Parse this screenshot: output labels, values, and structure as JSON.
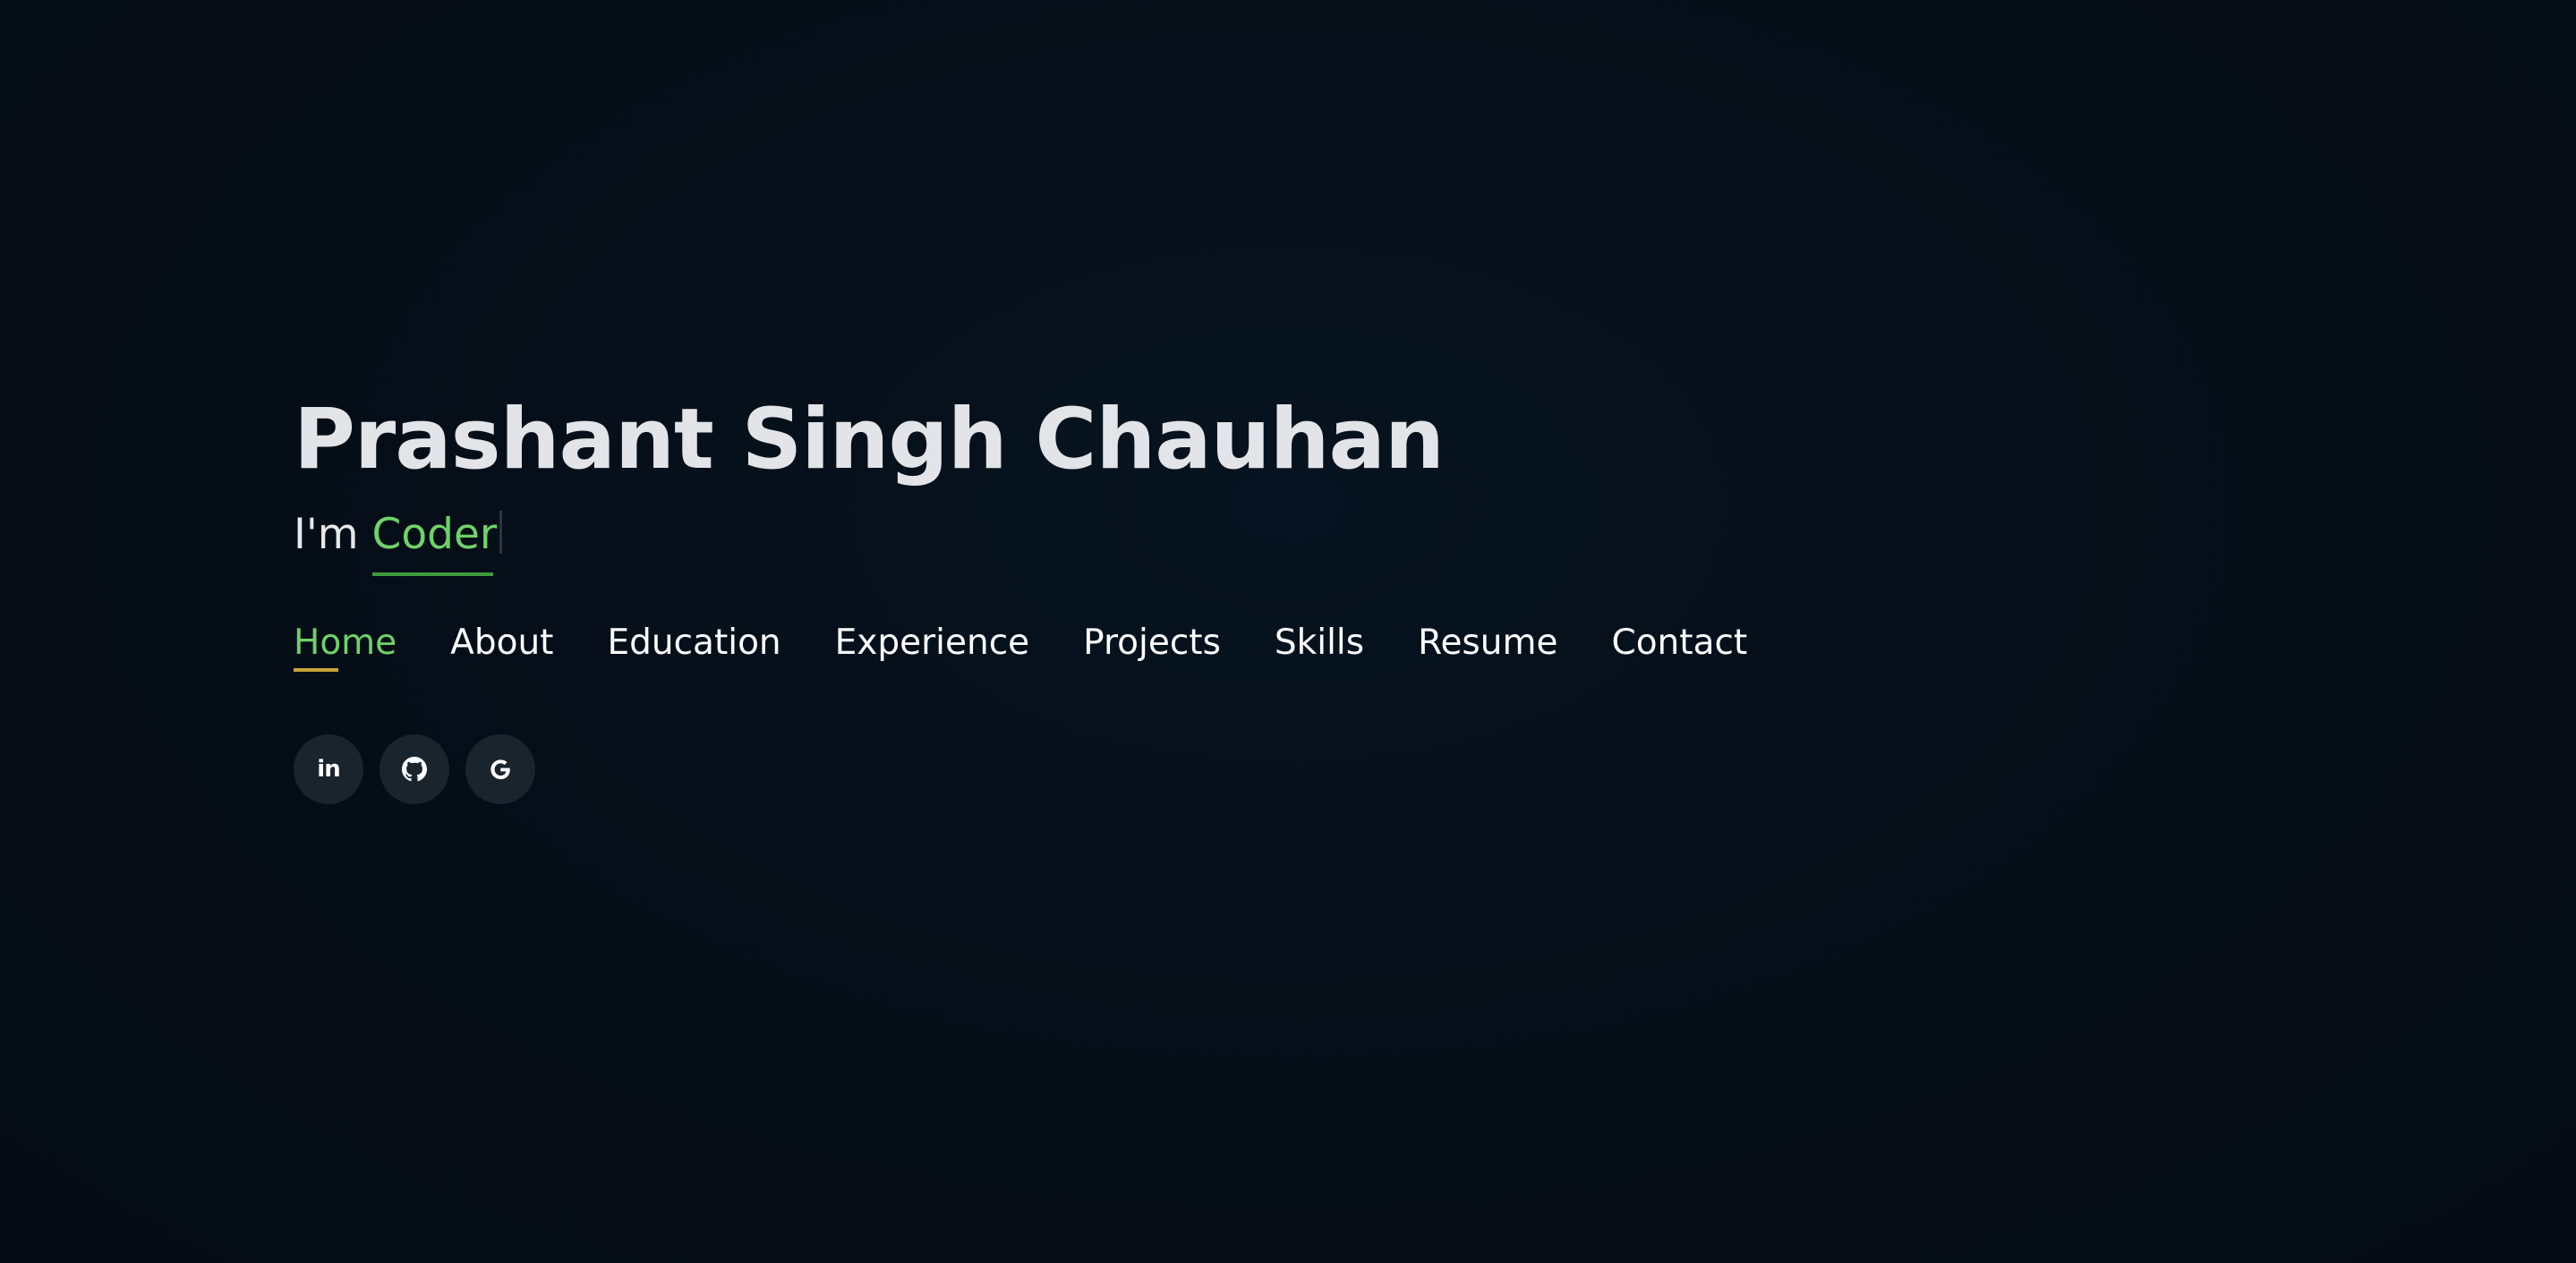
{
  "hero": {
    "name": "Prashant Singh Chauhan",
    "tagline_prefix": "I'm",
    "tagline_role": "Coder"
  },
  "nav": {
    "items": [
      {
        "label": "Home",
        "active": true
      },
      {
        "label": "About",
        "active": false
      },
      {
        "label": "Education",
        "active": false
      },
      {
        "label": "Experience",
        "active": false
      },
      {
        "label": "Projects",
        "active": false
      },
      {
        "label": "Skills",
        "active": false
      },
      {
        "label": "Resume",
        "active": false
      },
      {
        "label": "Contact",
        "active": false
      }
    ]
  },
  "social": {
    "icons": [
      "linkedin-icon",
      "github-icon",
      "google-icon"
    ],
    "linkedin_text": "in"
  },
  "colors": {
    "background": "#050d16",
    "accent_green": "#6fd268",
    "active_underline": "#c9a53a",
    "name_text": "#e2e4e8",
    "social_bg": "#1a242d"
  }
}
